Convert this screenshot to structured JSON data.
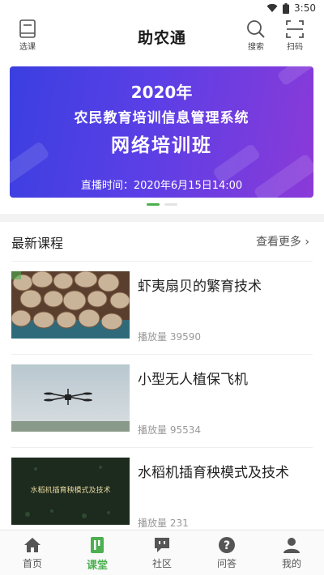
{
  "status_bar": {
    "time": "3:50"
  },
  "header": {
    "title": "助农通",
    "left_button": {
      "label": "选课",
      "icon": "book-icon"
    },
    "right_buttons": [
      {
        "label": "搜索",
        "icon": "search-icon"
      },
      {
        "label": "扫码",
        "icon": "scan-icon"
      }
    ]
  },
  "banner": {
    "line1": "2020年",
    "line2": "农民教育培训信息管理系统",
    "line3": "网络培训班",
    "line4": "直播时间：2020年6月15日14:00",
    "active_slide": 1,
    "slide_count": 2
  },
  "section": {
    "title": "最新课程",
    "more": "查看更多 ›"
  },
  "courses": [
    {
      "title": "虾夷扇贝的繁育技术",
      "views": "播放量 39590",
      "thumb": "scallops"
    },
    {
      "title": "小型无人植保飞机",
      "views": "播放量 95534",
      "thumb": "drone"
    },
    {
      "title": "水稻机插育秧模式及技术",
      "views": "播放量 231",
      "thumb": "rice-title",
      "thumb_text": "水稻机插育秧模式及技术"
    }
  ],
  "tabbar": [
    {
      "label": "首页",
      "icon": "home-icon",
      "active": false
    },
    {
      "label": "课堂",
      "icon": "classroom-icon",
      "active": true
    },
    {
      "label": "社区",
      "icon": "community-icon",
      "active": false
    },
    {
      "label": "问答",
      "icon": "question-icon",
      "active": false
    },
    {
      "label": "我的",
      "icon": "user-icon",
      "active": false
    }
  ],
  "colors": {
    "accent": "#4caf50",
    "banner_start": "#3b3fe0",
    "banner_end": "#8b3ad8"
  }
}
